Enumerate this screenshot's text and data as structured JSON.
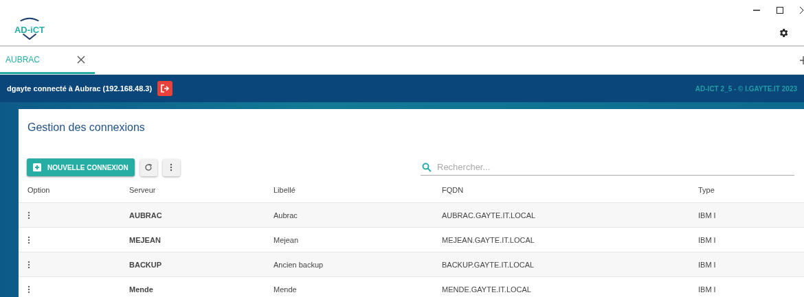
{
  "header": {
    "logo": "AD-iCT"
  },
  "tabs": [
    {
      "label": "AUBRAC",
      "selected": true
    }
  ],
  "session_bar": {
    "user": "dgayte connecté à Aubrac (192.168.48.3)",
    "version": "AD-ICT 2_5 - © I.GAYTE.IT 2023"
  },
  "panel": {
    "title": "Gestion des connexions",
    "new_button": "NOUVELLE CONNEXION",
    "search": {
      "placeholder": "Rechercher..."
    }
  },
  "table": {
    "columns": [
      "Option",
      "Serveur",
      "Libellé",
      "FQDN",
      "Type"
    ],
    "rows": [
      {
        "server": "AUBRAC",
        "label": "Aubrac",
        "fqdn": "AUBRAC.GAYTE.IT.LOCAL",
        "type": "IBM I"
      },
      {
        "server": "MEJEAN",
        "label": "Mejean",
        "fqdn": "MEJEAN.GAYTE.IT.LOCAL",
        "type": "IBM I"
      },
      {
        "server": "BACKUP",
        "label": "Ancien backup",
        "fqdn": "BACKUP.GAYTE.IT.LOCAL",
        "type": "IBM I"
      },
      {
        "server": "Mende",
        "label": "Mende",
        "fqdn": "MENDE.GAYTE.IT.LOCAL",
        "type": "IBM I"
      }
    ]
  }
}
